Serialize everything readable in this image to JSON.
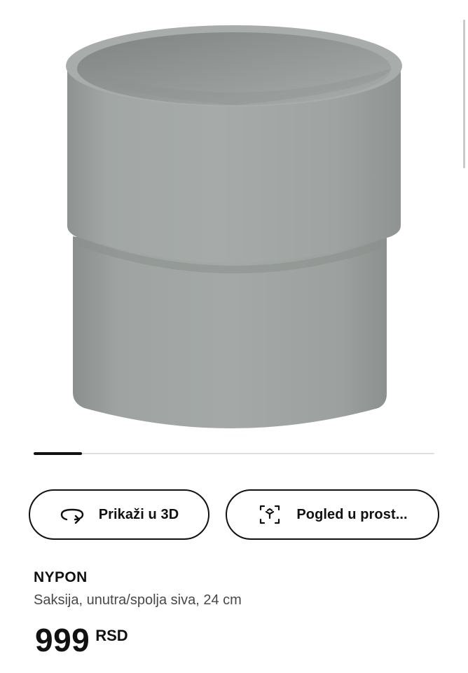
{
  "product_image": {
    "alt": "NYPON Saksija, unutra/spolja siva, 24 cm",
    "pot_color": "#9da2a0",
    "carousel_progress": 0.12
  },
  "actions": {
    "view_3d": {
      "label": "Prikaži u 3D",
      "icon": "rotate-3d-icon"
    },
    "view_in_room": {
      "label": "Pogled u prost...",
      "icon": "augmented-reality-icon"
    }
  },
  "product": {
    "name": "NYPON",
    "description": "Saksija, unutra/spolja siva, 24 cm",
    "price": {
      "integer": "999",
      "currency": "RSD"
    }
  },
  "colors": {
    "text_primary": "#111111",
    "text_secondary": "#484848",
    "border": "#111111"
  }
}
